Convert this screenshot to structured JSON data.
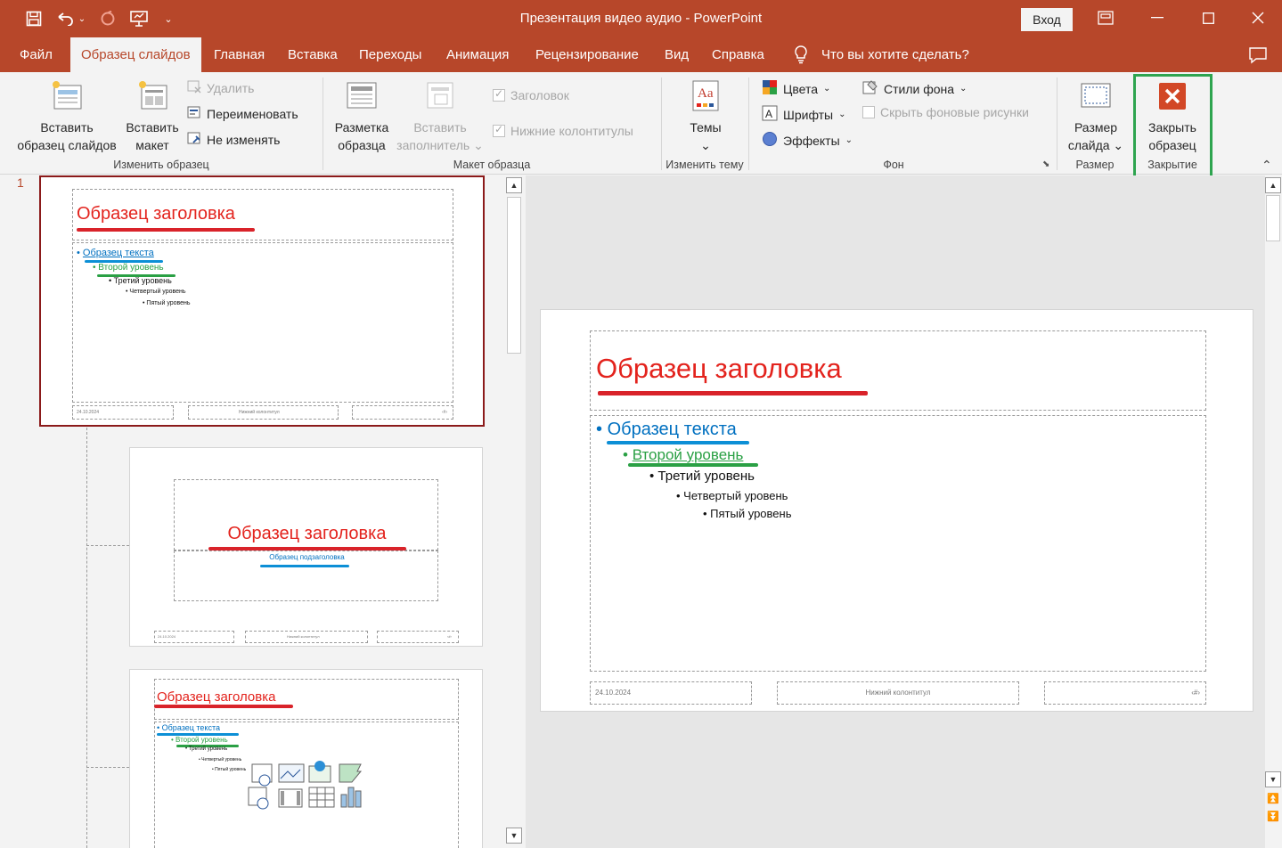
{
  "window": {
    "title": "Презентация видео аудио  -  PowerPoint",
    "login_label": "Вход",
    "quick_access": [
      "save-icon",
      "undo-icon",
      "redo-icon",
      "present-icon",
      "customize-icon"
    ]
  },
  "tabs": [
    {
      "label": "Файл",
      "active": false
    },
    {
      "label": "Образец слайдов",
      "active": true
    },
    {
      "label": "Главная",
      "active": false
    },
    {
      "label": "Вставка",
      "active": false
    },
    {
      "label": "Переходы",
      "active": false
    },
    {
      "label": "Анимация",
      "active": false
    },
    {
      "label": "Рецензирование",
      "active": false
    },
    {
      "label": "Вид",
      "active": false
    },
    {
      "label": "Справка",
      "active": false
    }
  ],
  "search": {
    "placeholder": "Что вы хотите сделать?"
  },
  "ribbon": {
    "group_edit_master": {
      "label": "Изменить образец",
      "insert_master_l1": "Вставить",
      "insert_master_l2": "образец слайдов",
      "insert_layout_l1": "Вставить",
      "insert_layout_l2": "макет",
      "delete": "Удалить",
      "rename": "Переименовать",
      "preserve": "Не изменять"
    },
    "group_master_layout": {
      "label": "Макет образца",
      "master_layout_l1": "Разметка",
      "master_layout_l2": "образца",
      "insert_placeholder_l1": "Вставить",
      "insert_placeholder_l2": "заполнитель",
      "title_chk": "Заголовок",
      "footers_chk": "Нижние колонтитулы"
    },
    "group_edit_theme": {
      "label": "Изменить тему",
      "themes": "Темы"
    },
    "group_background": {
      "label": "Фон",
      "colors": "Цвета",
      "fonts": "Шрифты",
      "effects": "Эффекты",
      "bg_styles": "Стили фона",
      "hide_bg": "Скрыть фоновые рисунки"
    },
    "group_size": {
      "label": "Размер",
      "slide_size_l1": "Размер",
      "slide_size_l2": "слайда"
    },
    "group_close": {
      "label": "Закрытие",
      "close_l1": "Закрыть",
      "close_l2": "образец"
    }
  },
  "thumbnails": {
    "slide_number": "1",
    "master": {
      "title": "Образец заголовка",
      "level1": "Образец текста",
      "level2": "Второй уровень",
      "level3": "Третий уровень",
      "level4": "Четвертый уровень",
      "level5": "Пятый уровень",
      "footer_date": "24.10.2024",
      "footer_text": "Нижний колонтитул",
      "footer_num": "‹#›"
    },
    "layout_title": {
      "title": "Образец заголовка",
      "subtitle": "Образец подзаголовка",
      "footer_date": "24.10.2024",
      "footer_text": "Нижний колонтитул",
      "footer_num": "‹#›"
    },
    "layout_content": {
      "title": "Образец заголовка",
      "level1": "Образец текста",
      "level2": "Второй уровень",
      "level3": "Третий уровень",
      "level4": "Четвертый уровень",
      "level5": "Пятый уровень"
    }
  },
  "main_slide": {
    "title": "Образец заголовка",
    "level1": "Образец текста",
    "level2": "Второй уровень",
    "level3": "Третий уровень",
    "level4": "Четвертый уровень",
    "level5": "Пятый уровень",
    "footer_date": "24.10.2024",
    "footer_text": "Нижний колонтитул",
    "footer_num": "‹#›"
  },
  "colors": {
    "accent": "#b7472a",
    "title_red": "#e3231d",
    "level1_blue": "#0070c0",
    "level2_green": "#2aa044",
    "highlight_box": "#2ea44f"
  }
}
